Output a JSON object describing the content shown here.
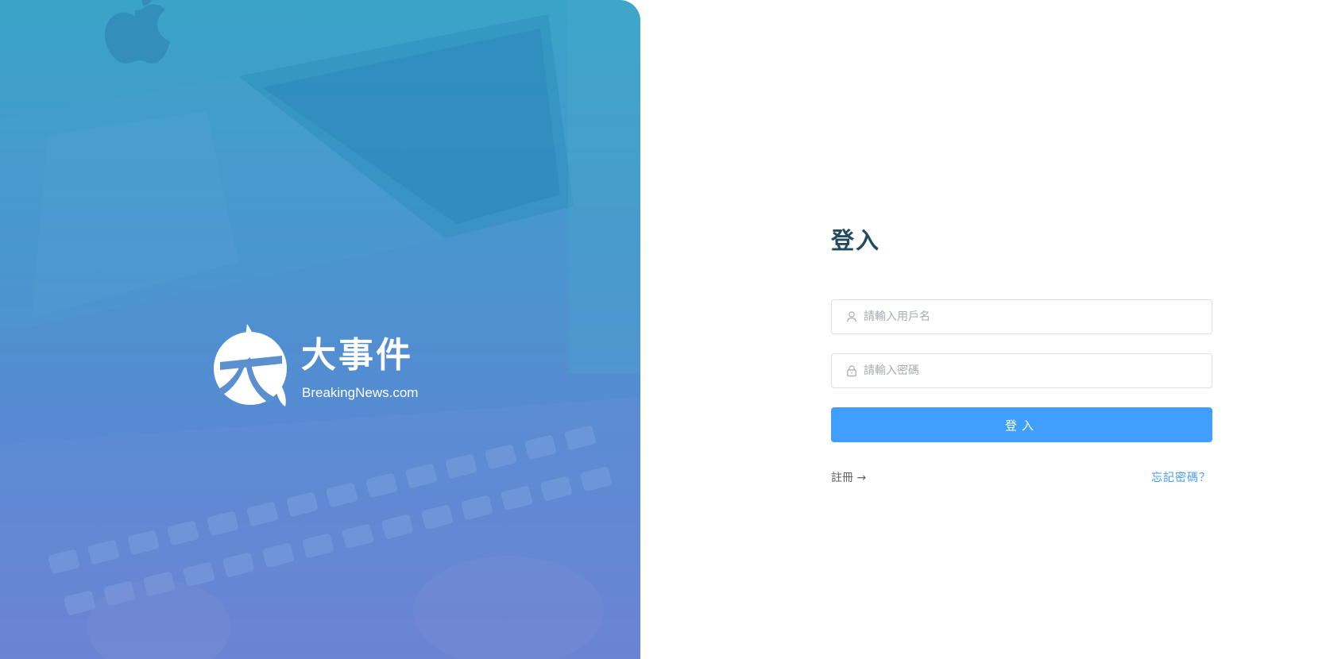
{
  "hero": {
    "brand_title": "大事件",
    "brand_domain": "BreakingNews.com",
    "logo_icon": "breakingnews-logo-icon",
    "background_icon": "apple-logo-icon"
  },
  "login": {
    "title": "登入",
    "username": {
      "placeholder": "請輸入用戶名",
      "value": "",
      "icon": "user-icon"
    },
    "password": {
      "placeholder": "請輸入密碼",
      "value": "",
      "icon": "lock-icon"
    },
    "submit_label": "登入",
    "register_label": "註冊 →",
    "forgot_label": "忘記密碼？"
  },
  "colors": {
    "primary": "#409eff",
    "title": "#234a5e",
    "hero_top": "#3aa4c8",
    "hero_bottom": "#6b7fd2"
  }
}
